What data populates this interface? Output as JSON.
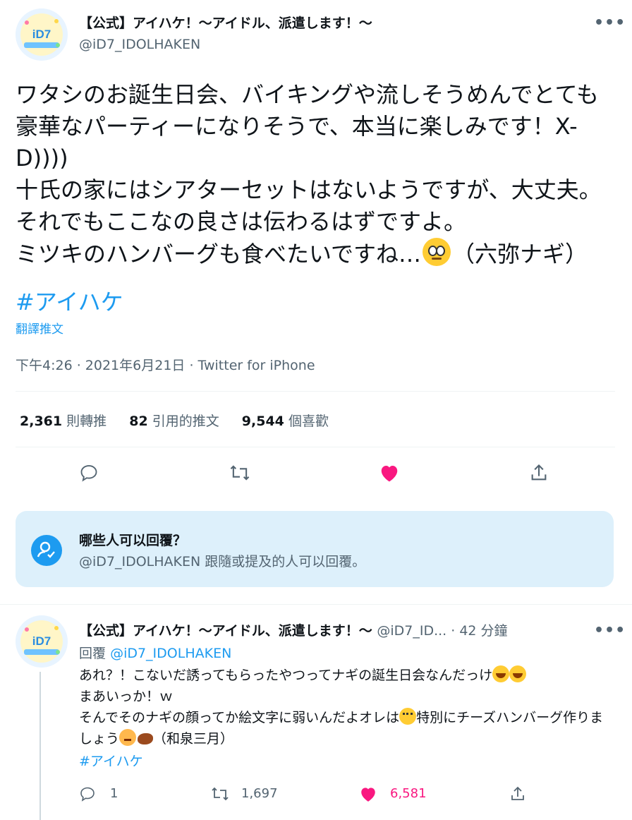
{
  "tweet": {
    "author_name": "【公式】アイハケ！〜アイドル、派遣します！〜",
    "author_handle": "@iD7_IDOLHAKEN",
    "text_part1": "ワタシのお誕生日会、バイキングや流しそうめんでとても豪華なパーティーになりそうで、本当に楽しみです！X-D))))\n十氏の家にはシアターセットはないようですが、大丈夫。それでもここなの良さは伝わるはずですよ。\nミツキのハンバーグも食べたいですね…",
    "emoji_1": "face-with-rolling-eyes",
    "text_part2": "（六弥ナギ）",
    "hashtag": "#アイハケ",
    "translate_label": "翻譯推文",
    "timestamp": "下午4:26 · 2021年6月21日 · Twitter for iPhone",
    "stats": {
      "retweets_count": "2,361",
      "retweets_label": "則轉推",
      "quotes_count": "82",
      "quotes_label": "引用的推文",
      "likes_count": "9,544",
      "likes_label": "個喜歡"
    },
    "liked": true
  },
  "reply_restriction": {
    "title": "哪些人可以回覆？",
    "subtitle": "@iD7_IDOLHAKEN 跟隨或提及的人可以回覆。"
  },
  "reply": {
    "author_name": "【公式】アイハケ！〜アイドル、派遣します！〜",
    "author_handle_time": "@iD7_ID... · 42 分鐘",
    "replying_to_label": "回覆",
    "replying_to_handle": "@iD7_IDOLHAKEN",
    "line1": "あれ？！こないだ誘ってもらったやつってナギの誕生日会なんだっけ",
    "line2": "まあいっか！ｗ",
    "line3a": "そんでそのナギの顔ってか絵文字に弱いんだよオレは",
    "line3b": "特別にチーズハンバーグ作りましょう",
    "line3c": "（和泉三月）",
    "hashtag": "#アイハケ",
    "reply_count": "1",
    "retweet_count": "1,697",
    "like_count": "6,581"
  },
  "colors": {
    "accent": "#1d9bf0",
    "like": "#f91880",
    "muted": "#536471",
    "reply_box_bg": "#ddf0fb"
  }
}
